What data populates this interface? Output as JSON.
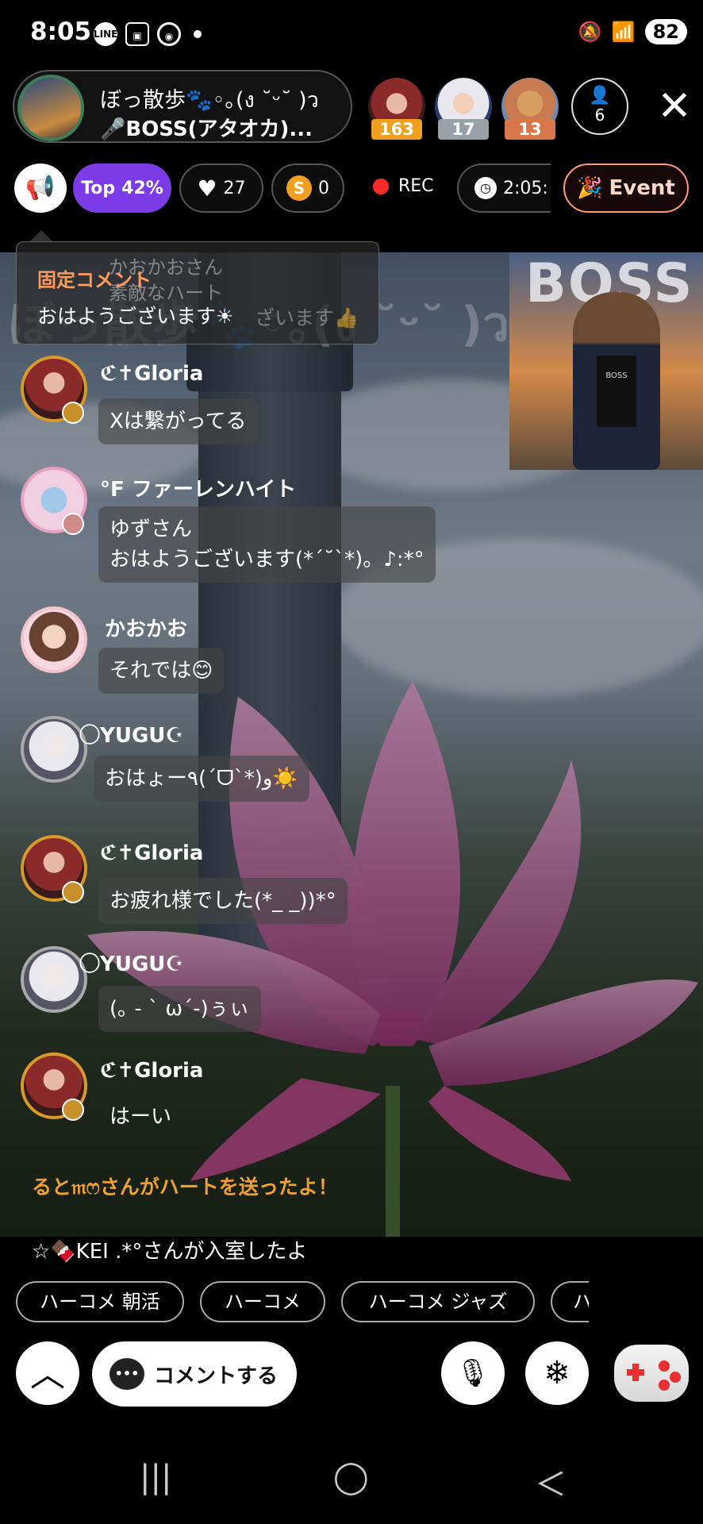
{
  "status_bar": {
    "time": "8:05",
    "icons": [
      "LINE",
      "screenshot-icon",
      "chrome-icon",
      "dot"
    ],
    "battery": "82"
  },
  "header": {
    "host_name": "ぼっ散歩🐾◦｡(ง ˘ᵕ˘ )ว",
    "host_subtitle": "🎤BOSS(アタオカ)...",
    "top_fans": [
      {
        "count": "163",
        "color": "#f0a020"
      },
      {
        "count": "17",
        "color": "#9aa0a8"
      },
      {
        "count": "13",
        "color": "#d8784a"
      }
    ],
    "viewers": "6"
  },
  "toolbar": {
    "top_label": "Top",
    "top_percent": "42%",
    "hearts": "27",
    "coin_symbol": "S",
    "coins": "0",
    "rec_label": "REC",
    "timer": "2:05:",
    "event_label": "Event"
  },
  "pinned": {
    "title": "固定コメント",
    "text": "おはようございます☀",
    "ghost_line1": "かおかおさん",
    "ghost_line2": "素敵なハート",
    "ghost_line3": "ざいます👍"
  },
  "watermark": "ぼっ散歩🐾◦｡(ง ˘ᵕ˘ )ว",
  "thumbnail": {
    "title": "BOSS",
    "shirt_text": "BOSS"
  },
  "comments": [
    {
      "name": "ℭ✝Gloria",
      "text": "Xは繋がってる"
    },
    {
      "name": "°F ファーレンハイト",
      "text": "ゆずさん\nおはようございます(*´˘`*)。♪:*°"
    },
    {
      "name": "かおかお",
      "text": "それでは😊"
    },
    {
      "name": "⃝YUGU☪",
      "text": "おはょー٩(´ᗜ`*)و☀️"
    },
    {
      "name": "ℭ✝Gloria",
      "text": "お疲れ様でした(*_ _))*°"
    },
    {
      "name": "⃝YUGU☪",
      "text": "(｡ - ` ω´-)ぅぃ"
    },
    {
      "name": "ℭ✝Gloria",
      "text": "はーい"
    }
  ],
  "system_messages": {
    "heart": "ると𝔪ෆさんがハートを送ったよ！",
    "join": "☆🍫KEI .*°さんが入室したよ"
  },
  "quick_replies": [
    "ハーコメ 朝活",
    "ハーコメ",
    "ハーコメ ジャズ",
    "ハ"
  ],
  "bottom": {
    "comment_label": "コメントする"
  },
  "nav": {
    "recent": "|||",
    "home": "◯",
    "back": "＜"
  }
}
